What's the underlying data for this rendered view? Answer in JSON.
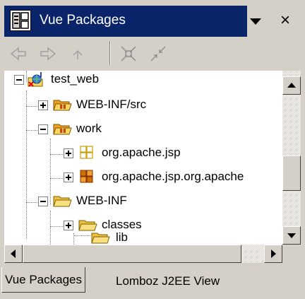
{
  "window": {
    "title": "Vue Packages",
    "menu_icon": "chevron-down-icon",
    "close_label": "×"
  },
  "toolbar": {
    "back_icon": "back-arrow-icon",
    "forward_icon": "forward-arrow-icon",
    "up_icon": "up-arrow-icon",
    "collapse_icon": "collapse-all-icon",
    "link_icon": "link-with-editor-icon"
  },
  "tree": {
    "items": [
      {
        "label": "test_web",
        "icon": "web-project-icon",
        "expanded": true,
        "depth": 0
      },
      {
        "label": "WEB-INF/src",
        "icon": "source-folder-icon",
        "expanded": false,
        "depth": 1
      },
      {
        "label": "work",
        "icon": "source-folder-icon",
        "expanded": true,
        "depth": 1
      },
      {
        "label": "org.apache.jsp",
        "icon": "empty-package-icon",
        "expanded": false,
        "depth": 2
      },
      {
        "label": "org.apache.jsp.org.apache",
        "icon": "package-icon",
        "expanded": false,
        "depth": 2
      },
      {
        "label": "WEB-INF",
        "icon": "folder-icon",
        "expanded": true,
        "depth": 1
      },
      {
        "label": "classes",
        "icon": "folder-icon",
        "expanded": false,
        "depth": 2
      },
      {
        "label": "lib",
        "icon": "folder-icon",
        "expanded": null,
        "depth": 2
      }
    ]
  },
  "tabs": [
    {
      "label": "Vue Packages",
      "active": true
    },
    {
      "label": "Lomboz J2EE View",
      "active": false
    }
  ],
  "colors": {
    "titlebar": "#0a246a",
    "chrome": "#d4d0c8",
    "folder_yellow": "#f8d860",
    "package_orange": "#c86400"
  }
}
